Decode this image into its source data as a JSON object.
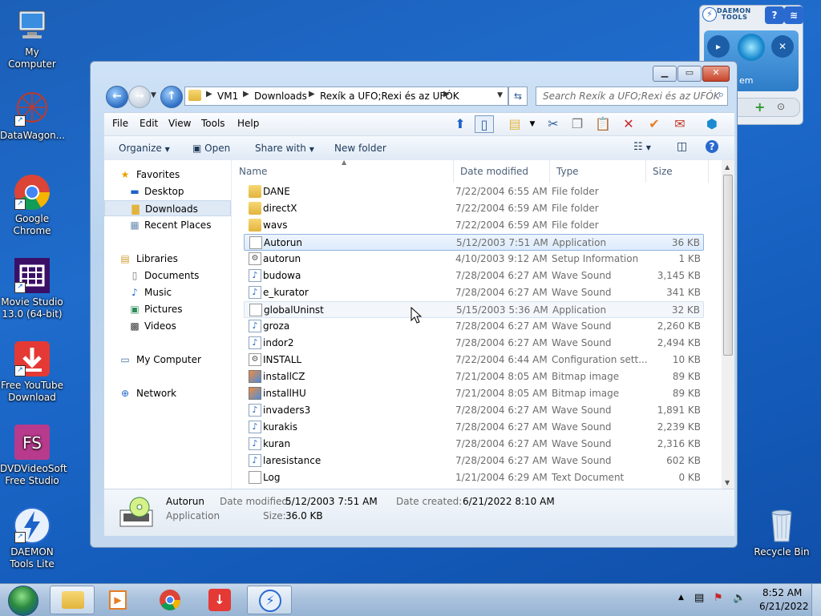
{
  "desktop": {
    "icons": [
      {
        "label_line1": "My Computer",
        "label_line2": ""
      },
      {
        "label_line1": "DataWagon...",
        "label_line2": ""
      },
      {
        "label_line1": "Google",
        "label_line2": "Chrome"
      },
      {
        "label_line1": "Movie Studio",
        "label_line2": "13.0 (64-bit)"
      },
      {
        "label_line1": "Free YouTube",
        "label_line2": "Download"
      },
      {
        "label_line1": "DVDVideoSoft",
        "label_line2": "Free Studio"
      },
      {
        "label_line1": "DAEMON",
        "label_line2": "Tools Lite"
      },
      {
        "label_line1": "Recycle Bin",
        "label_line2": ""
      }
    ],
    "daemon_gadget": {
      "title_line1": "DAEMON",
      "title_line2": "TOOLS",
      "help": "?",
      "panel_text": "em"
    }
  },
  "explorer": {
    "breadcrumb": [
      "VM1",
      "Downloads",
      "Rexík a UFO;Rexi és az UFÓK"
    ],
    "search_placeholder": "Search Rexík a UFO;Rexi és az UFÓK",
    "menu": [
      "File",
      "Edit",
      "View",
      "Tools",
      "Help"
    ],
    "commands": {
      "organize": "Organize",
      "open": "Open",
      "share_with": "Share with",
      "new_folder": "New folder"
    },
    "nav": {
      "favorites": "Favorites",
      "desktop": "Desktop",
      "downloads": "Downloads",
      "recent_places": "Recent Places",
      "libraries": "Libraries",
      "documents": "Documents",
      "music": "Music",
      "pictures": "Pictures",
      "videos": "Videos",
      "my_computer": "My Computer",
      "network": "Network"
    },
    "columns": {
      "name": "Name",
      "date": "Date modified",
      "type": "Type",
      "size": "Size"
    },
    "files": [
      {
        "name": "DANE",
        "date": "7/22/2004 6:55 AM",
        "type": "File folder",
        "size": "",
        "icon": "folder"
      },
      {
        "name": "directX",
        "date": "7/22/2004 6:59 AM",
        "type": "File folder",
        "size": "",
        "icon": "folder"
      },
      {
        "name": "wavs",
        "date": "7/22/2004 6:59 AM",
        "type": "File folder",
        "size": "",
        "icon": "folder"
      },
      {
        "name": "Autorun",
        "date": "5/12/2003 7:51 AM",
        "type": "Application",
        "size": "36 KB",
        "icon": "app"
      },
      {
        "name": "autorun",
        "date": "4/10/2003 9:12 AM",
        "type": "Setup Information",
        "size": "1 KB",
        "icon": "cfg"
      },
      {
        "name": "budowa",
        "date": "7/28/2004 6:27 AM",
        "type": "Wave Sound",
        "size": "3,145 KB",
        "icon": "wav"
      },
      {
        "name": "e_kurator",
        "date": "7/28/2004 6:27 AM",
        "type": "Wave Sound",
        "size": "341 KB",
        "icon": "wav"
      },
      {
        "name": "globalUninst",
        "date": "5/15/2003 5:36 AM",
        "type": "Application",
        "size": "32 KB",
        "icon": "app"
      },
      {
        "name": "groza",
        "date": "7/28/2004 6:27 AM",
        "type": "Wave Sound",
        "size": "2,260 KB",
        "icon": "wav"
      },
      {
        "name": "indor2",
        "date": "7/28/2004 6:27 AM",
        "type": "Wave Sound",
        "size": "2,494 KB",
        "icon": "wav"
      },
      {
        "name": "INSTALL",
        "date": "7/22/2004 6:44 AM",
        "type": "Configuration sett...",
        "size": "10 KB",
        "icon": "cfg"
      },
      {
        "name": "installCZ",
        "date": "7/21/2004 8:05 AM",
        "type": "Bitmap image",
        "size": "89 KB",
        "icon": "bmp"
      },
      {
        "name": "installHU",
        "date": "7/21/2004 8:05 AM",
        "type": "Bitmap image",
        "size": "89 KB",
        "icon": "bmp"
      },
      {
        "name": "invaders3",
        "date": "7/28/2004 6:27 AM",
        "type": "Wave Sound",
        "size": "1,891 KB",
        "icon": "wav"
      },
      {
        "name": "kurakis",
        "date": "7/28/2004 6:27 AM",
        "type": "Wave Sound",
        "size": "2,239 KB",
        "icon": "wav"
      },
      {
        "name": "kuran",
        "date": "7/28/2004 6:27 AM",
        "type": "Wave Sound",
        "size": "2,316 KB",
        "icon": "wav"
      },
      {
        "name": "laresistance",
        "date": "7/28/2004 6:27 AM",
        "type": "Wave Sound",
        "size": "602 KB",
        "icon": "wav"
      },
      {
        "name": "Log",
        "date": "1/21/2004 6:29 AM",
        "type": "Text Document",
        "size": "0 KB",
        "icon": "txt"
      }
    ],
    "details": {
      "name": "Autorun",
      "type": "Application",
      "modified_label": "Date modified:",
      "modified_value": "5/12/2003 7:51 AM",
      "created_label": "Date created:",
      "created_value": "6/21/2022 8:10 AM",
      "size_label": "Size:",
      "size_value": "36.0 KB"
    }
  },
  "taskbar": {
    "time": "8:52 AM",
    "date": "6/21/2022"
  }
}
